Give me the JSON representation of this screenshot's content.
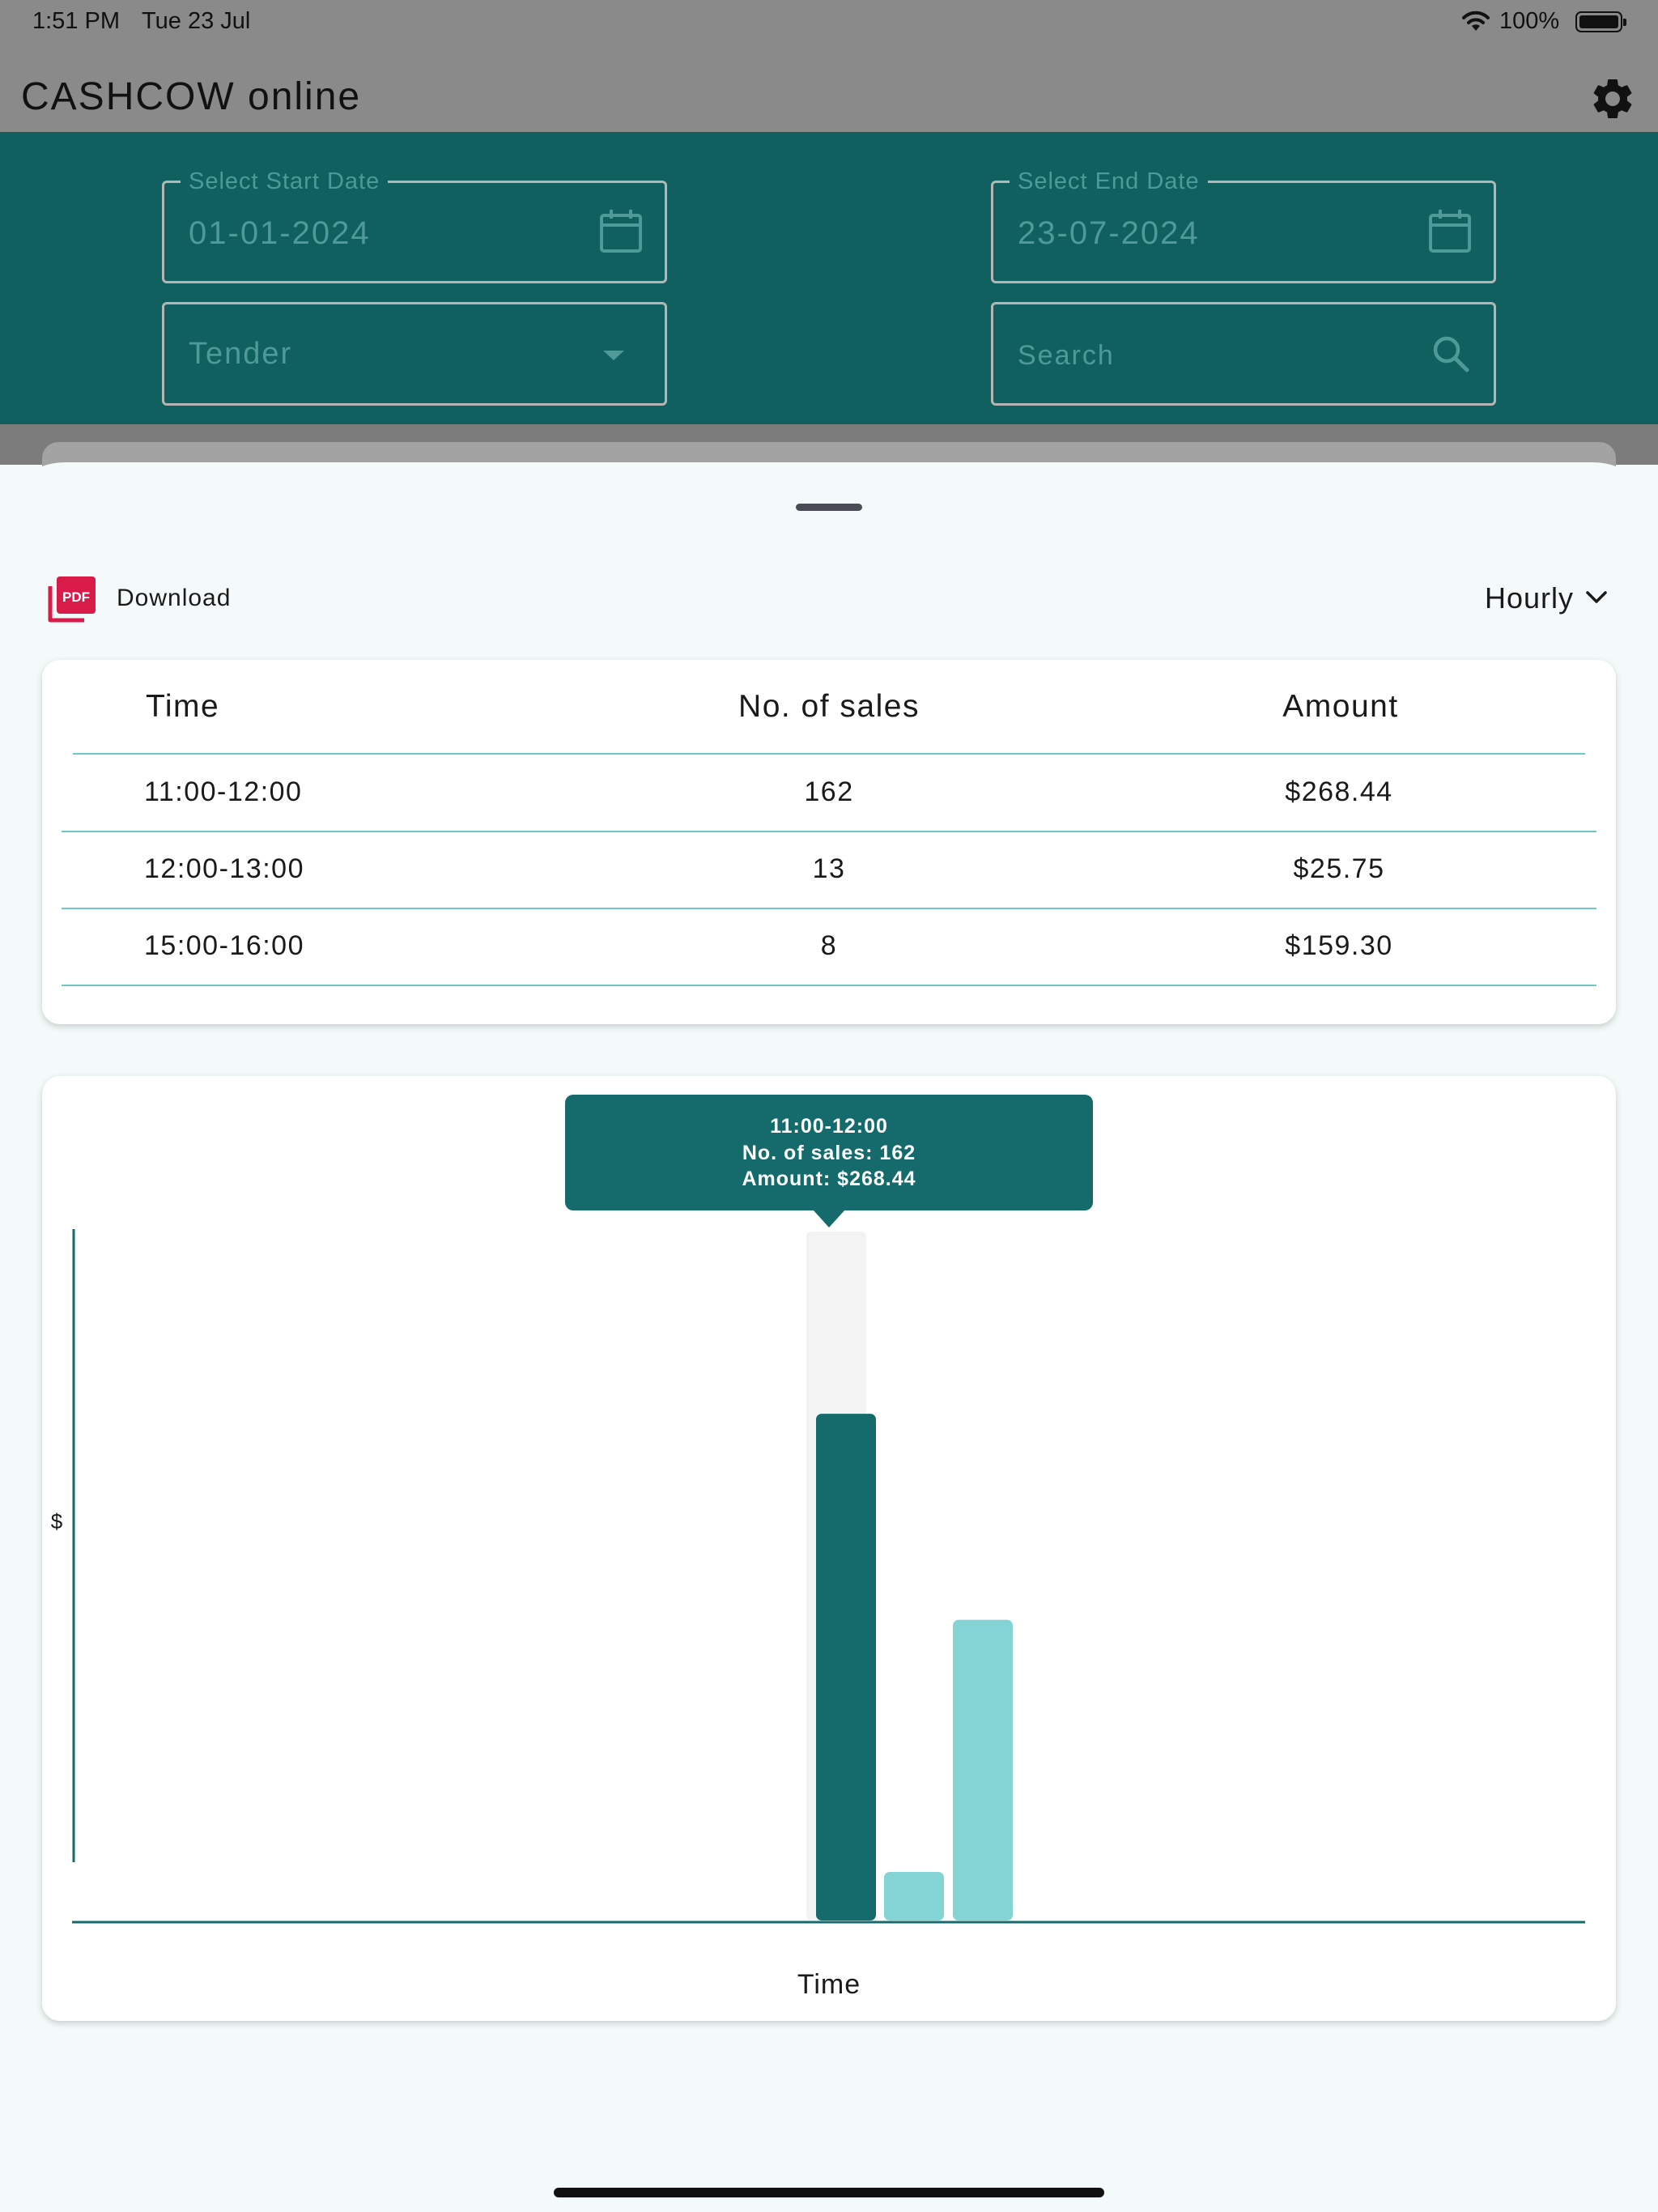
{
  "status_bar": {
    "time": "1:51 PM",
    "date": "Tue 23 Jul",
    "battery_percent": "100%"
  },
  "app_bar": {
    "title": "CASHCOW online"
  },
  "filters": {
    "start_date": {
      "label": "Select Start Date",
      "value": "01-01-2024"
    },
    "end_date": {
      "label": "Select End Date",
      "value": "23-07-2024"
    },
    "tender": {
      "placeholder": "Tender"
    },
    "search": {
      "placeholder": "Search"
    }
  },
  "sheet": {
    "download_label": "Download",
    "pdf_badge": "PDF",
    "period_selector": "Hourly"
  },
  "table": {
    "headers": {
      "time": "Time",
      "sales": "No. of sales",
      "amount": "Amount"
    },
    "rows": [
      {
        "time": "11:00-12:00",
        "sales": "162",
        "amount": "$268.44"
      },
      {
        "time": "12:00-13:00",
        "sales": "13",
        "amount": "$25.75"
      },
      {
        "time": "15:00-16:00",
        "sales": "8",
        "amount": "$159.30"
      }
    ]
  },
  "tooltip": {
    "title": "11:00-12:00",
    "sales_line": "No. of sales: 162",
    "amount_line": "Amount: $268.44"
  },
  "colors": {
    "teal_dark": "#156b6c",
    "teal_light": "#84d4d5",
    "filter_bg": "#10605f"
  },
  "chart_data": {
    "type": "bar",
    "categories": [
      "11:00-12:00",
      "12:00-13:00",
      "15:00-16:00"
    ],
    "values": [
      268.44,
      25.75,
      159.3
    ],
    "highlighted_index": 0,
    "xlabel": "Time",
    "ylabel": "$",
    "ylim": [
      0,
      365
    ],
    "grid": false
  }
}
